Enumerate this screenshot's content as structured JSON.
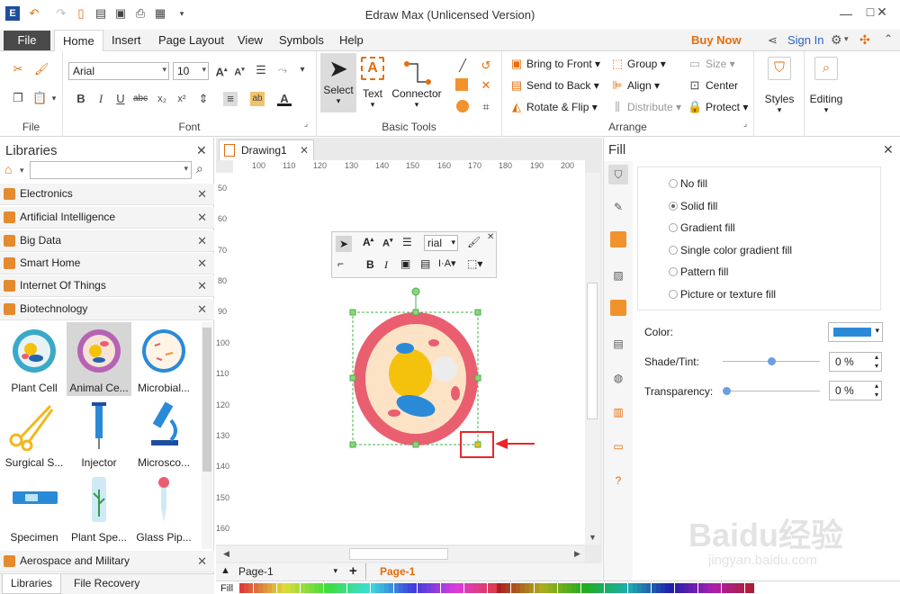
{
  "app": {
    "title": "Edraw Max (Unlicensed Version)"
  },
  "colors": {
    "accent_orange": "#e46d0e",
    "link_blue": "#2a63c7",
    "fill_color": "#2b8ad8",
    "cell_pink": "#e95f70",
    "selection_green": "#45b04a",
    "annotation_red": "#e8262b"
  },
  "menu": {
    "file": "File",
    "tabs": [
      "Home",
      "Insert",
      "Page Layout",
      "View",
      "Symbols",
      "Help"
    ],
    "buy_now": "Buy Now",
    "sign_in": "Sign In"
  },
  "ribbon": {
    "file_group": "File",
    "font_group": "Font",
    "font_name": "Arial",
    "font_size": "10",
    "basic_tools_group": "Basic Tools",
    "select": "Select",
    "text": "Text",
    "connector": "Connector",
    "arrange_group": "Arrange",
    "bring_to_front": "Bring to Front",
    "send_to_back": "Send to Back",
    "rotate_flip": "Rotate & Flip",
    "group": "Group",
    "align": "Align",
    "distribute": "Distribute",
    "size": "Size",
    "center": "Center",
    "protect": "Protect",
    "styles": "Styles",
    "editing": "Editing"
  },
  "libraries": {
    "header": "Libraries",
    "categories": [
      "Electronics",
      "Artificial Intelligence",
      "Big Data",
      "Smart Home",
      "Internet Of Things",
      "Biotechnology"
    ],
    "shapes": [
      "Plant Cell",
      "Animal Ce...",
      "Microbial...",
      "Surgical S...",
      "Injector",
      "Microsco...",
      "Specimen",
      "Plant Spe...",
      "Glass Pip..."
    ],
    "bottom_category": "Aerospace and Military",
    "bottom_tabs": [
      "Libraries",
      "File Recovery"
    ]
  },
  "canvas": {
    "doc_tab": "Drawing1",
    "ruler_h": [
      "100",
      "110",
      "120",
      "130",
      "140",
      "150",
      "160",
      "170",
      "180",
      "190",
      "200"
    ],
    "ruler_v": [
      "50",
      "60",
      "70",
      "80",
      "90",
      "100",
      "110",
      "120",
      "130",
      "140",
      "150",
      "160"
    ],
    "float_font": "rial",
    "page_selector": "Page-1",
    "page_tab": "Page-1",
    "fill_label": "Fill"
  },
  "fill_panel": {
    "title": "Fill",
    "options": [
      "No fill",
      "Solid fill",
      "Gradient fill",
      "Single color gradient fill",
      "Pattern fill",
      "Picture or texture fill"
    ],
    "selected_option": "Solid fill",
    "color_label": "Color:",
    "shade_label": "Shade/Tint:",
    "shade_value": "0 %",
    "transparency_label": "Transparency:",
    "transparency_value": "0 %"
  },
  "watermark": {
    "brand": "Baidu经验",
    "url": "jingyan.baidu.com"
  }
}
